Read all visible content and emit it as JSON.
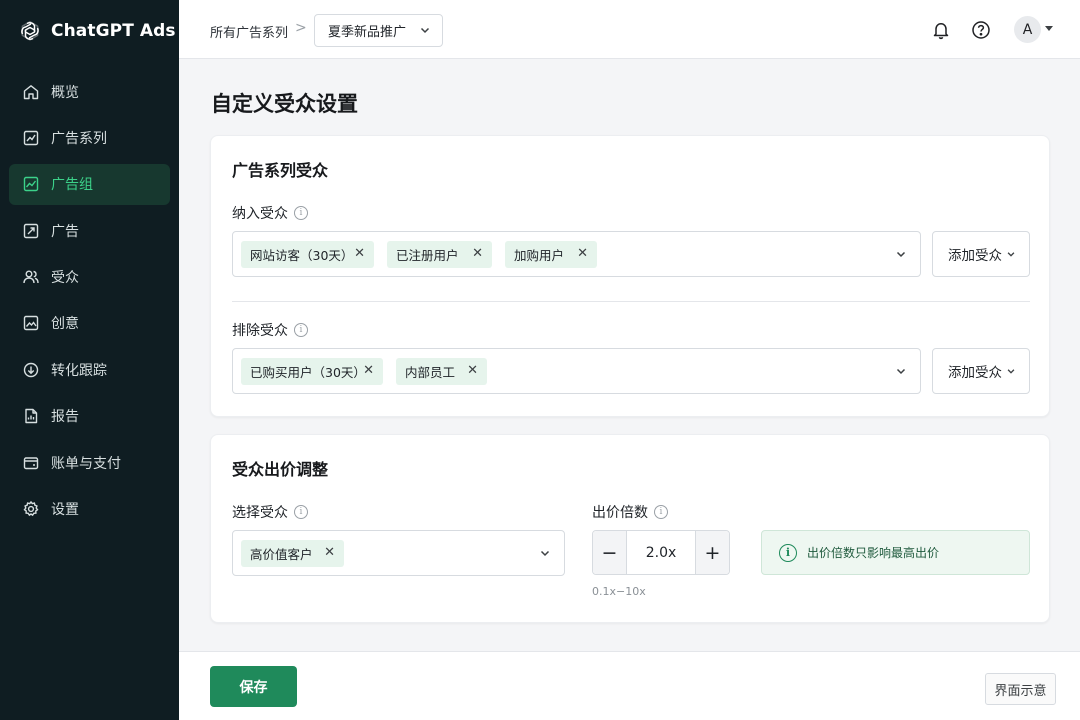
{
  "app": {
    "name": "ChatGPT Ads"
  },
  "colors": {
    "sidebar_bg": "#0f1d22",
    "accent": "#1f8a5b",
    "active_text": "#3cd28a",
    "chip_bg": "#e6f4ec"
  },
  "sidebar": {
    "items": [
      {
        "label": "概览",
        "icon": "home-icon"
      },
      {
        "label": "广告系列",
        "icon": "chart-box-icon"
      },
      {
        "label": "广告组",
        "icon": "chart-group-icon",
        "active": true
      },
      {
        "label": "广告",
        "icon": "ad-icon"
      },
      {
        "label": "受众",
        "icon": "users-icon"
      },
      {
        "label": "创意",
        "icon": "image-icon"
      },
      {
        "label": "转化跟踪",
        "icon": "conversion-icon"
      },
      {
        "label": "报告",
        "icon": "report-icon"
      },
      {
        "label": "账单与支付",
        "icon": "wallet-icon"
      },
      {
        "label": "设置",
        "icon": "gear-icon"
      }
    ]
  },
  "header": {
    "breadcrumb": "所有广告系列",
    "breadcrumb_sep": ">",
    "campaign_select": "夏季新品推广",
    "avatar_initial": "A"
  },
  "page": {
    "title": "自定义受众设置"
  },
  "campaign_audience": {
    "title": "广告系列受众",
    "include": {
      "label": "纳入受众",
      "chips": [
        "网站访客（30天）",
        "已注册用户",
        "加购用户"
      ],
      "add_label": "添加受众"
    },
    "exclude": {
      "label": "排除受众",
      "chips": [
        "已购买用户（30天）",
        "内部员工"
      ],
      "add_label": "添加受众"
    }
  },
  "bid_adjust": {
    "title": "受众出价调整",
    "select_label": "选择受众",
    "selected_chip": "高价值客户",
    "multiplier_label": "出价倍数",
    "multiplier_value": "2.0x",
    "minus": "−",
    "plus": "+",
    "range_hint": "0.1x−10x",
    "notice": "出价倍数只影响最高出价"
  },
  "footer": {
    "save_label": "保存",
    "demo_tag": "界面示意"
  }
}
